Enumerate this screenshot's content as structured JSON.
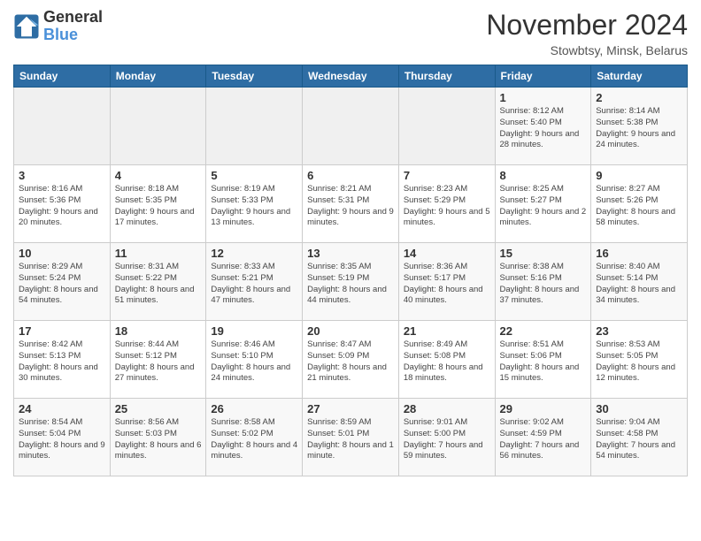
{
  "header": {
    "logo_line1": "General",
    "logo_line2": "Blue",
    "month": "November 2024",
    "location": "Stowbtsy, Minsk, Belarus"
  },
  "weekdays": [
    "Sunday",
    "Monday",
    "Tuesday",
    "Wednesday",
    "Thursday",
    "Friday",
    "Saturday"
  ],
  "weeks": [
    [
      {
        "day": "",
        "info": ""
      },
      {
        "day": "",
        "info": ""
      },
      {
        "day": "",
        "info": ""
      },
      {
        "day": "",
        "info": ""
      },
      {
        "day": "",
        "info": ""
      },
      {
        "day": "1",
        "info": "Sunrise: 8:12 AM\nSunset: 5:40 PM\nDaylight: 9 hours and 28 minutes."
      },
      {
        "day": "2",
        "info": "Sunrise: 8:14 AM\nSunset: 5:38 PM\nDaylight: 9 hours and 24 minutes."
      }
    ],
    [
      {
        "day": "3",
        "info": "Sunrise: 8:16 AM\nSunset: 5:36 PM\nDaylight: 9 hours and 20 minutes."
      },
      {
        "day": "4",
        "info": "Sunrise: 8:18 AM\nSunset: 5:35 PM\nDaylight: 9 hours and 17 minutes."
      },
      {
        "day": "5",
        "info": "Sunrise: 8:19 AM\nSunset: 5:33 PM\nDaylight: 9 hours and 13 minutes."
      },
      {
        "day": "6",
        "info": "Sunrise: 8:21 AM\nSunset: 5:31 PM\nDaylight: 9 hours and 9 minutes."
      },
      {
        "day": "7",
        "info": "Sunrise: 8:23 AM\nSunset: 5:29 PM\nDaylight: 9 hours and 5 minutes."
      },
      {
        "day": "8",
        "info": "Sunrise: 8:25 AM\nSunset: 5:27 PM\nDaylight: 9 hours and 2 minutes."
      },
      {
        "day": "9",
        "info": "Sunrise: 8:27 AM\nSunset: 5:26 PM\nDaylight: 8 hours and 58 minutes."
      }
    ],
    [
      {
        "day": "10",
        "info": "Sunrise: 8:29 AM\nSunset: 5:24 PM\nDaylight: 8 hours and 54 minutes."
      },
      {
        "day": "11",
        "info": "Sunrise: 8:31 AM\nSunset: 5:22 PM\nDaylight: 8 hours and 51 minutes."
      },
      {
        "day": "12",
        "info": "Sunrise: 8:33 AM\nSunset: 5:21 PM\nDaylight: 8 hours and 47 minutes."
      },
      {
        "day": "13",
        "info": "Sunrise: 8:35 AM\nSunset: 5:19 PM\nDaylight: 8 hours and 44 minutes."
      },
      {
        "day": "14",
        "info": "Sunrise: 8:36 AM\nSunset: 5:17 PM\nDaylight: 8 hours and 40 minutes."
      },
      {
        "day": "15",
        "info": "Sunrise: 8:38 AM\nSunset: 5:16 PM\nDaylight: 8 hours and 37 minutes."
      },
      {
        "day": "16",
        "info": "Sunrise: 8:40 AM\nSunset: 5:14 PM\nDaylight: 8 hours and 34 minutes."
      }
    ],
    [
      {
        "day": "17",
        "info": "Sunrise: 8:42 AM\nSunset: 5:13 PM\nDaylight: 8 hours and 30 minutes."
      },
      {
        "day": "18",
        "info": "Sunrise: 8:44 AM\nSunset: 5:12 PM\nDaylight: 8 hours and 27 minutes."
      },
      {
        "day": "19",
        "info": "Sunrise: 8:46 AM\nSunset: 5:10 PM\nDaylight: 8 hours and 24 minutes."
      },
      {
        "day": "20",
        "info": "Sunrise: 8:47 AM\nSunset: 5:09 PM\nDaylight: 8 hours and 21 minutes."
      },
      {
        "day": "21",
        "info": "Sunrise: 8:49 AM\nSunset: 5:08 PM\nDaylight: 8 hours and 18 minutes."
      },
      {
        "day": "22",
        "info": "Sunrise: 8:51 AM\nSunset: 5:06 PM\nDaylight: 8 hours and 15 minutes."
      },
      {
        "day": "23",
        "info": "Sunrise: 8:53 AM\nSunset: 5:05 PM\nDaylight: 8 hours and 12 minutes."
      }
    ],
    [
      {
        "day": "24",
        "info": "Sunrise: 8:54 AM\nSunset: 5:04 PM\nDaylight: 8 hours and 9 minutes."
      },
      {
        "day": "25",
        "info": "Sunrise: 8:56 AM\nSunset: 5:03 PM\nDaylight: 8 hours and 6 minutes."
      },
      {
        "day": "26",
        "info": "Sunrise: 8:58 AM\nSunset: 5:02 PM\nDaylight: 8 hours and 4 minutes."
      },
      {
        "day": "27",
        "info": "Sunrise: 8:59 AM\nSunset: 5:01 PM\nDaylight: 8 hours and 1 minute."
      },
      {
        "day": "28",
        "info": "Sunrise: 9:01 AM\nSunset: 5:00 PM\nDaylight: 7 hours and 59 minutes."
      },
      {
        "day": "29",
        "info": "Sunrise: 9:02 AM\nSunset: 4:59 PM\nDaylight: 7 hours and 56 minutes."
      },
      {
        "day": "30",
        "info": "Sunrise: 9:04 AM\nSunset: 4:58 PM\nDaylight: 7 hours and 54 minutes."
      }
    ]
  ]
}
